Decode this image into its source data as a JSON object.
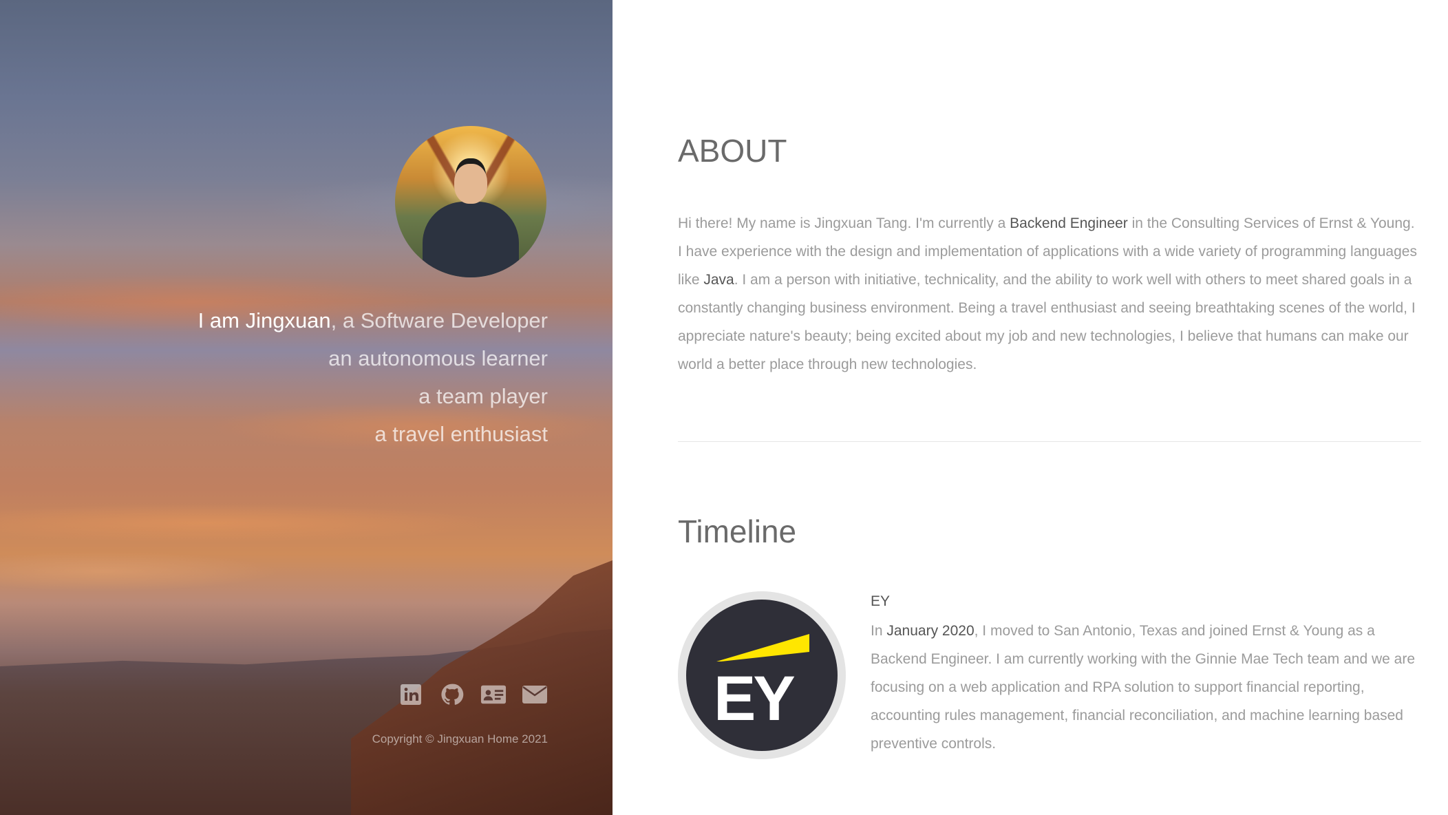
{
  "hero": {
    "intro_name": "I am Jingxuan",
    "intro_role": ", a Software Developer",
    "traits": [
      "an autonomous learner",
      "a team player",
      "a travel enthusiast"
    ],
    "social_icons": [
      "linkedin-icon",
      "github-icon",
      "contact-card-icon",
      "envelope-icon"
    ],
    "copyright": "Copyright © Jingxuan Home 2021"
  },
  "about": {
    "heading": "ABOUT",
    "p1": "Hi there! My name is Jingxuan Tang. I'm currently a ",
    "em1": "Backend Engineer",
    "p2": " in the Consulting Services of Ernst & Young. I have experience with the design and implementation of applications with a wide variety of programming languages like ",
    "em2": "Java",
    "p3": ". I am a person with initiative, technicality, and the ability to work well with others to meet shared goals in a constantly changing business environment. Being a travel enthusiast and seeing breathtaking scenes of the world, I appreciate nature's beauty; being excited about my job and new technologies, I believe that humans can make our world a better place through new technologies."
  },
  "timeline": {
    "heading": "Timeline",
    "items": [
      {
        "logo_text": "EY",
        "title": "EY",
        "t1": "In ",
        "em": "January 2020",
        "t2": ", I moved to San Antonio, Texas and joined Ernst & Young as a Backend Engineer. I am currently working with the Ginnie Mae Tech team and we are focusing on a web application and RPA solution to support financial reporting, accounting rules management, financial reconciliation, and machine learning based preventive controls."
      }
    ]
  },
  "colors": {
    "heading": "#6a6a6a",
    "body_text": "#9b9b9b",
    "emphasis": "#555555",
    "ey_yellow": "#ffe600",
    "ey_dark": "#2f2f38"
  }
}
